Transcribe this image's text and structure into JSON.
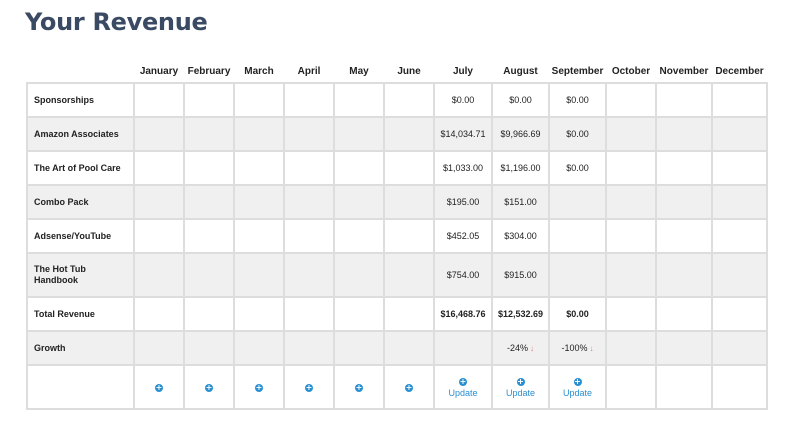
{
  "page": {
    "title": "Your Revenue"
  },
  "table": {
    "months": [
      "January",
      "February",
      "March",
      "April",
      "May",
      "June",
      "July",
      "August",
      "September",
      "October",
      "November",
      "December"
    ],
    "rows": [
      {
        "label": "Sponsorships",
        "values": [
          "",
          "",
          "",
          "",
          "",
          "",
          "$0.00",
          "$0.00",
          "$0.00",
          "",
          "",
          ""
        ]
      },
      {
        "label": "Amazon Associates",
        "values": [
          "",
          "",
          "",
          "",
          "",
          "",
          "$14,034.71",
          "$9,966.69",
          "$0.00",
          "",
          "",
          ""
        ]
      },
      {
        "label": "The Art of Pool Care",
        "values": [
          "",
          "",
          "",
          "",
          "",
          "",
          "$1,033.00",
          "$1,196.00",
          "$0.00",
          "",
          "",
          ""
        ]
      },
      {
        "label": "Combo Pack",
        "values": [
          "",
          "",
          "",
          "",
          "",
          "",
          "$195.00",
          "$151.00",
          "",
          "",
          "",
          ""
        ]
      },
      {
        "label": "Adsense/YouTube",
        "values": [
          "",
          "",
          "",
          "",
          "",
          "",
          "$452.05",
          "$304.00",
          "",
          "",
          "",
          ""
        ]
      },
      {
        "label": "The Hot Tub Handbook",
        "values": [
          "",
          "",
          "",
          "",
          "",
          "",
          "$754.00",
          "$915.00",
          "",
          "",
          "",
          ""
        ]
      },
      {
        "label": "Total Revenue",
        "values": [
          "",
          "",
          "",
          "",
          "",
          "",
          "$16,468.76",
          "$12,532.69",
          "$0.00",
          "",
          "",
          ""
        ]
      },
      {
        "label": "Growth",
        "values": [
          "",
          "",
          "",
          "",
          "",
          "",
          "",
          "-24%",
          "-100%",
          "",
          "",
          ""
        ]
      }
    ],
    "update_label": "Update",
    "add_icon": "plus-circle-icon",
    "decline_icon": "arrow-down-icon",
    "accent_color": "#2a8fd0",
    "decline_color": "#e08080"
  }
}
